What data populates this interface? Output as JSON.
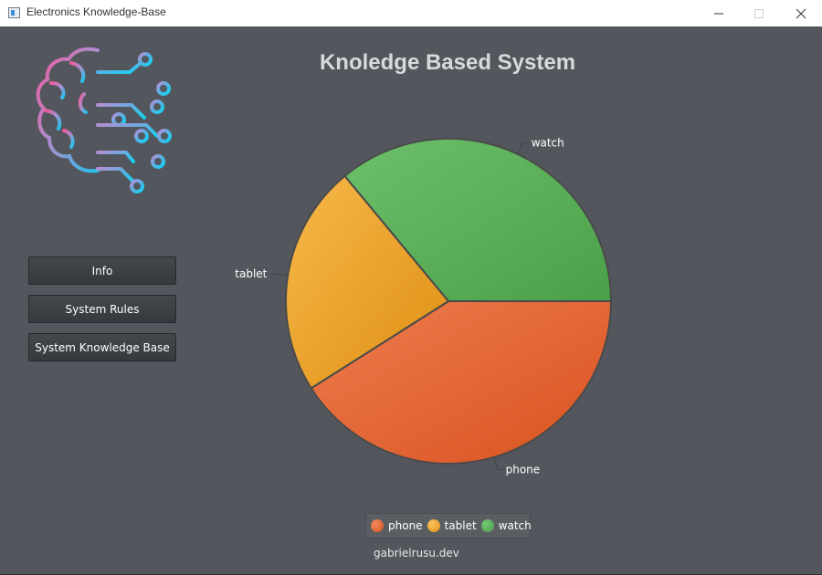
{
  "window": {
    "title": "Electronics Knowledge-Base",
    "controls": {
      "minimize": "minimize-icon",
      "maximize": "maximize-icon",
      "close": "close-icon"
    }
  },
  "sidebar": {
    "logo": "brain-circuit-logo",
    "buttons": {
      "info": "Info",
      "rules": "System Rules",
      "knowledge_base": "System Knowledge Base"
    }
  },
  "main": {
    "title": "Knoledge Based System"
  },
  "chart_data": {
    "type": "pie",
    "slices": [
      {
        "label": "phone",
        "value": 41,
        "color": "#e2592a"
      },
      {
        "label": "tablet",
        "value": 23,
        "color": "#f0a020"
      },
      {
        "label": "watch",
        "value": 36,
        "color": "#5aad55"
      }
    ],
    "legend": "bottom"
  },
  "footer": {
    "text": "gabrielrusu.dev"
  }
}
